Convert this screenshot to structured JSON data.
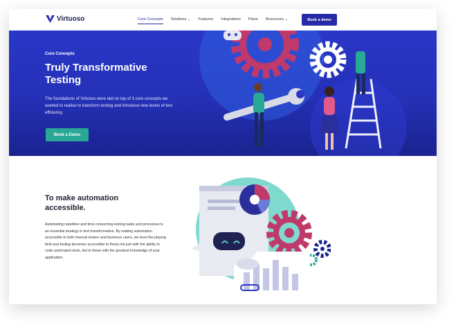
{
  "nav": {
    "brand": "Virtuoso",
    "items": [
      {
        "label": "Core Concepts"
      },
      {
        "label": "Solutions ⌄"
      },
      {
        "label": "Features"
      },
      {
        "label": "Integrations"
      },
      {
        "label": "Plans"
      },
      {
        "label": "Resources ⌄"
      }
    ],
    "cta": "Book a demo"
  },
  "hero": {
    "eyebrow": "Core Concepts",
    "title": "Truly Transformative Testing",
    "description": "The foundations of Virtuoso were laid on top of 3 core concepts we wanted to realise to transform testing and introduce new levels of test efficiency.",
    "cta": "Book a Demo"
  },
  "section": {
    "title": "To make automation accessible.",
    "description": "Automating repetitive and time consuming testing tasks and processes is an essential strategy in test transformation. By making automation accessible to both manual testers and business users, we level the playing field and testing becomes accessible to those not just with the ability to code automated tests, but to those with the greatest knowledge of your application."
  },
  "colors": {
    "brand_navy": "#262aa6",
    "hero_blue": "#2a37c7",
    "teal": "#2aa896",
    "gear_pink": "#c0396b"
  }
}
